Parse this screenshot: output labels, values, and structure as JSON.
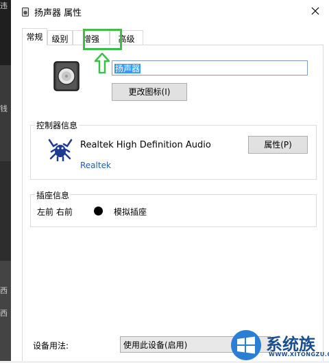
{
  "background_window": {
    "chars": [
      "违",
      "钱",
      "西",
      "西"
    ]
  },
  "titlebar": {
    "title": "扬声器 属性",
    "icon": "speaker-small-icon",
    "close_icon": "close-icon"
  },
  "tabs": [
    {
      "label": "常规",
      "active": true
    },
    {
      "label": "级别",
      "active": false
    },
    {
      "label": "增强",
      "active": false,
      "highlighted": true
    },
    {
      "label": "高级",
      "active": false
    }
  ],
  "annotation": {
    "highlight_color": "#3dbd4a",
    "arrow": "up-arrow-icon"
  },
  "general": {
    "device_icon": "speaker-icon",
    "name_value": "扬声器",
    "change_icon_button": "更改图标(I)",
    "controller_group_label": "控制器信息",
    "controller_icon": "realtek-crab-icon",
    "controller_name": "Realtek High Definition Audio",
    "controller_vendor": "Realtek",
    "properties_button": "属性(P)",
    "jack_group_label": "插座信息",
    "jack_position": "左前 右前",
    "jack_type": "模拟插座",
    "usage_label": "设备用法:",
    "usage_value": "使用此设备(启用)"
  },
  "watermark": {
    "text": "系统族",
    "url": "WWW.XITONGZU.COM",
    "logo": "windows-logo-icon",
    "color": "#1a4f8f"
  },
  "colors": {
    "link": "#1e5ea8",
    "selection": "#3399ff"
  }
}
